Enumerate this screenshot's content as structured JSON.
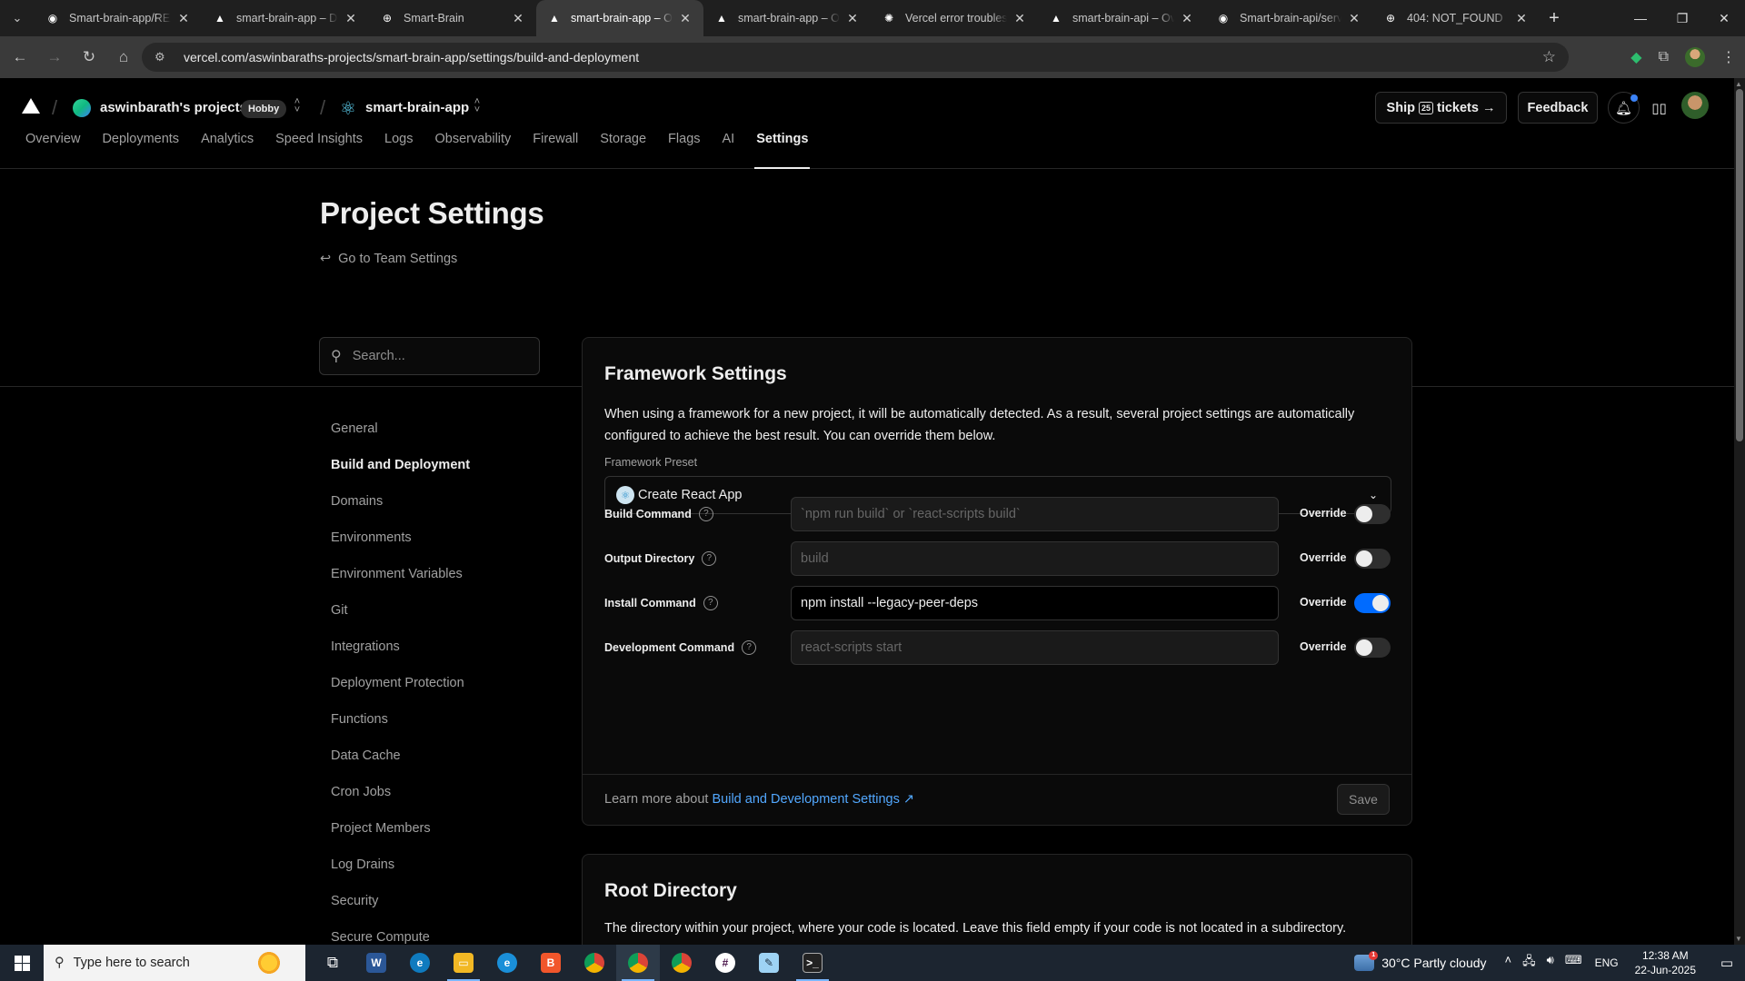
{
  "browser": {
    "tabs": [
      {
        "title": "Smart-brain-app/REA",
        "icon": "github-icon",
        "fav": "◉"
      },
      {
        "title": "smart-brain-app – De",
        "icon": "vercel-icon",
        "fav": "▲"
      },
      {
        "title": "Smart-Brain",
        "icon": "globe-icon",
        "fav": "⊕"
      },
      {
        "title": "smart-brain-app – Ov",
        "icon": "vercel-icon",
        "fav": "▲"
      },
      {
        "title": "smart-brain-app – Ov",
        "icon": "vercel-icon",
        "fav": "▲"
      },
      {
        "title": "Vercel error troublesh",
        "icon": "openai-icon",
        "fav": "✺"
      },
      {
        "title": "smart-brain-api – Ove",
        "icon": "vercel-icon",
        "fav": "▲"
      },
      {
        "title": "Smart-brain-api/serve",
        "icon": "github-icon",
        "fav": "◉"
      },
      {
        "title": "404: NOT_FOUND",
        "icon": "globe-icon",
        "fav": "⊕"
      }
    ],
    "active_tab_index": 3,
    "url": "vercel.com/aswinbaraths-projects/smart-brain-app/settings/build-and-deployment"
  },
  "header": {
    "team_name": "aswinbarath's projects",
    "plan_badge": "Hobby",
    "project_name": "smart-brain-app",
    "ship_label_1": "Ship",
    "ship_day": "25",
    "ship_label_2": "tickets",
    "feedback_label": "Feedback"
  },
  "nav_tabs": [
    "Overview",
    "Deployments",
    "Analytics",
    "Speed Insights",
    "Logs",
    "Observability",
    "Firewall",
    "Storage",
    "Flags",
    "AI",
    "Settings"
  ],
  "active_nav_tab": "Settings",
  "page": {
    "title": "Project Settings",
    "back_link": "Go to Team Settings",
    "search_placeholder": "Search..."
  },
  "sidebar": {
    "items": [
      "General",
      "Build and Deployment",
      "Domains",
      "Environments",
      "Environment Variables",
      "Git",
      "Integrations",
      "Deployment Protection",
      "Functions",
      "Data Cache",
      "Cron Jobs",
      "Project Members",
      "Log Drains",
      "Security",
      "Secure Compute"
    ],
    "active_item": "Build and Deployment"
  },
  "framework_settings": {
    "title": "Framework Settings",
    "description": "When using a framework for a new project, it will be automatically detected. As a result, several project settings are automatically configured to achieve the best result. You can override them below.",
    "preset_label": "Framework Preset",
    "preset_value": "Create React App",
    "rows": [
      {
        "label": "Build Command",
        "value": "",
        "placeholder": "`npm run build` or `react-scripts build`",
        "override_label": "Override",
        "override_on": false
      },
      {
        "label": "Output Directory",
        "value": "",
        "placeholder": "build",
        "override_label": "Override",
        "override_on": false
      },
      {
        "label": "Install Command",
        "value": "npm install --legacy-peer-deps",
        "placeholder": "",
        "override_label": "Override",
        "override_on": true
      },
      {
        "label": "Development Command",
        "value": "",
        "placeholder": "react-scripts start",
        "override_label": "Override",
        "override_on": false
      }
    ],
    "footer_text": "Learn more about",
    "footer_link": "Build and Development Settings",
    "save_label": "Save"
  },
  "root_directory": {
    "title": "Root Directory",
    "description": "The directory within your project, where your code is located. Leave this field empty if your code is not located in a subdirectory."
  },
  "taskbar": {
    "search_placeholder": "Type here to search",
    "weather": "30°C  Partly cloudy",
    "weather_badge": "1",
    "language": "ENG",
    "time": "12:38 AM",
    "date": "22-Jun-2025"
  },
  "colors": {
    "accent_blue": "#006bff",
    "link_blue": "#52a8ff",
    "background": "#000000",
    "card_bg": "#0a0a0a",
    "border": "#262626"
  }
}
